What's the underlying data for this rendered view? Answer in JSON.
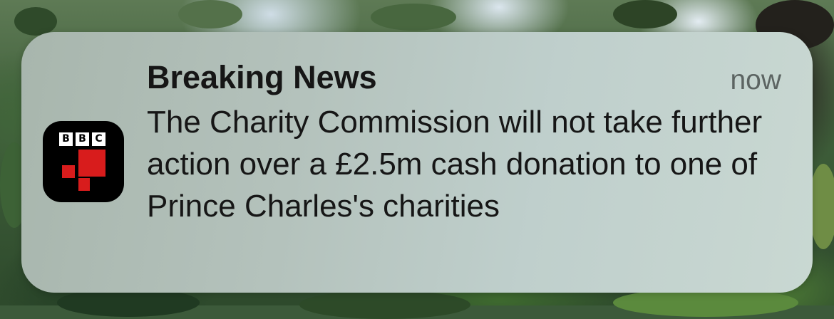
{
  "notification": {
    "app_icon": "bbc-news-icon",
    "app_icon_letters": [
      "B",
      "B",
      "C"
    ],
    "title": "Breaking News",
    "time": "now",
    "body": "The Charity Commission will not take further action over a £2.5m cash donation to one of Prince Charles's charities"
  },
  "colors": {
    "icon_background": "#000000",
    "icon_accent_red": "#d81c1c",
    "title_text": "#161616",
    "time_text": "#5c6462"
  }
}
